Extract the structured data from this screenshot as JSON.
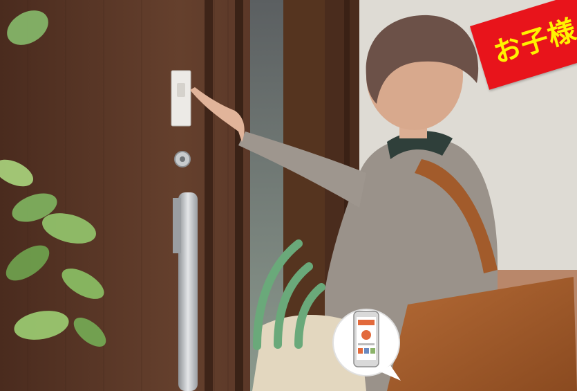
{
  "banner": {
    "text": "お子様"
  },
  "colors": {
    "door": "#5a3626",
    "wall": "#dcd9d2",
    "banner_bg": "#e8141b",
    "banner_text": "#fff200",
    "signal_waves": "#6aa97a"
  },
  "icons": [
    "smartphone-icon",
    "wireless-signal-icon"
  ]
}
